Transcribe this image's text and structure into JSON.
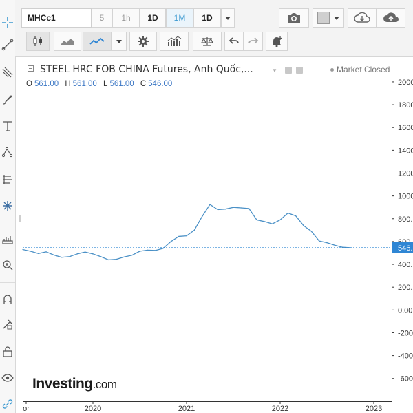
{
  "toolbar": {
    "symbol": "MHCc1",
    "intervals": [
      "5",
      "1h",
      "1D",
      "1M",
      "1D"
    ],
    "camera_icon": "camera-icon",
    "color_swatch": "#cfcfcf"
  },
  "header": {
    "title": "STEEL HRC FOB CHINA Futures, Anh Quốc,...",
    "status": "Market Closed",
    "ohlc": {
      "o_label": "O",
      "o": "561.00",
      "h_label": "H",
      "h": "561.00",
      "l_label": "L",
      "l": "561.00",
      "c_label": "C",
      "c": "546.00"
    }
  },
  "logo": {
    "brand": "Investing",
    "suffix": ".com"
  },
  "chart_data": {
    "type": "line",
    "x": [
      "2019-04",
      "2019-05",
      "2019-06",
      "2019-07",
      "2019-08",
      "2019-09",
      "2019-10",
      "2019-11",
      "2019-12",
      "2020-01",
      "2020-02",
      "2020-03",
      "2020-04",
      "2020-05",
      "2020-06",
      "2020-07",
      "2020-08",
      "2020-09",
      "2020-10",
      "2020-11",
      "2020-12",
      "2021-01",
      "2021-02",
      "2021-03",
      "2021-04",
      "2021-05",
      "2021-06",
      "2021-07",
      "2021-08",
      "2021-09",
      "2021-10",
      "2021-11",
      "2021-12",
      "2022-01",
      "2022-02",
      "2022-03",
      "2022-04",
      "2022-05",
      "2022-06",
      "2022-07",
      "2022-08",
      "2022-09",
      "2022-10"
    ],
    "values": [
      530,
      515,
      495,
      510,
      482,
      462,
      468,
      492,
      508,
      492,
      468,
      440,
      445,
      465,
      480,
      515,
      525,
      522,
      540,
      600,
      645,
      650,
      700,
      820,
      925,
      880,
      885,
      900,
      895,
      890,
      790,
      775,
      755,
      790,
      850,
      825,
      740,
      690,
      605,
      590,
      568,
      550,
      546
    ],
    "last_value_label": "546.",
    "x_ticks": [
      "or",
      "2020",
      "2021",
      "2022",
      "2023"
    ],
    "y_ticks": [
      2000,
      1800,
      1600,
      1400,
      1200,
      1000,
      800,
      600,
      400,
      200,
      0,
      -200,
      -400,
      -600
    ],
    "y_tick_labels": [
      "2000.",
      "1800.",
      "1600.",
      "1400.",
      "1200.",
      "1000.",
      "800.",
      "600.",
      "400.",
      "200.",
      "0.00",
      "-200.",
      "-400.",
      "-600."
    ],
    "ylim": [
      -680,
      2060
    ],
    "line_color": "#4a90c6",
    "last_price_color": "#2f86d4",
    "grid": false,
    "title": "STEEL HRC FOB CHINA Futures, Anh Quốc,..."
  }
}
